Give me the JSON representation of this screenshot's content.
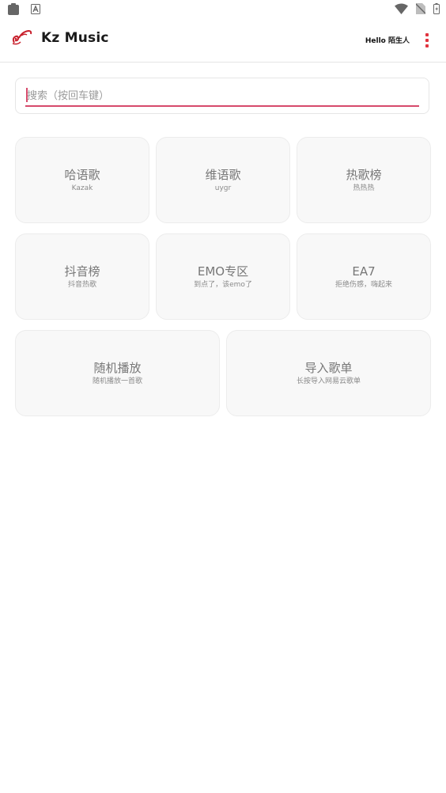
{
  "status_bar": {
    "left_icons": [
      "clipboard-icon",
      "font-a-icon"
    ],
    "right_icons": [
      "wifi-icon",
      "no-sim-icon",
      "battery-charging-icon"
    ]
  },
  "header": {
    "logo_icon": "dragon-logo-icon",
    "title": "Kz Music",
    "greeting": "Hello 陌生人",
    "menu_icon": "more-vertical-icon",
    "accent_color": "#e1343f"
  },
  "search": {
    "placeholder": "搜索（按回车键）",
    "value": "",
    "underline_color": "#d64a6b"
  },
  "tiles": [
    {
      "title": "哈语歌",
      "subtitle": "Kazak"
    },
    {
      "title": "维语歌",
      "subtitle": "uygr"
    },
    {
      "title": "热歌榜",
      "subtitle": "热热热"
    },
    {
      "title": "抖音榜",
      "subtitle": "抖音热歌"
    },
    {
      "title": "EMO专区",
      "subtitle": "到点了，该emo了"
    },
    {
      "title": "EA7",
      "subtitle": "拒绝伤感，嗨起来"
    },
    {
      "title": "随机播放",
      "subtitle": "随机播放一首歌"
    },
    {
      "title": "导入歌单",
      "subtitle": "长按导入网易云歌单"
    }
  ]
}
